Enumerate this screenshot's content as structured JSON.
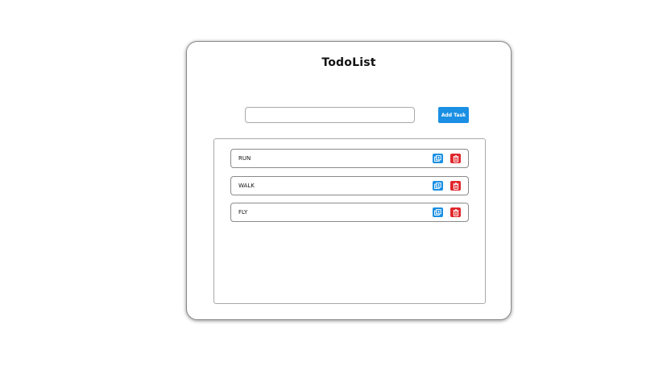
{
  "app": {
    "title": "TodoList"
  },
  "form": {
    "input_value": "",
    "input_placeholder": "",
    "add_button_label": "Add Task"
  },
  "tasks": [
    {
      "label": "RUN"
    },
    {
      "label": "WALK"
    },
    {
      "label": "FLY"
    }
  ],
  "icons": {
    "edit": "edit-icon",
    "delete": "trash-icon"
  },
  "colors": {
    "accent": "#1a8fe3",
    "danger": "#e0262b"
  }
}
